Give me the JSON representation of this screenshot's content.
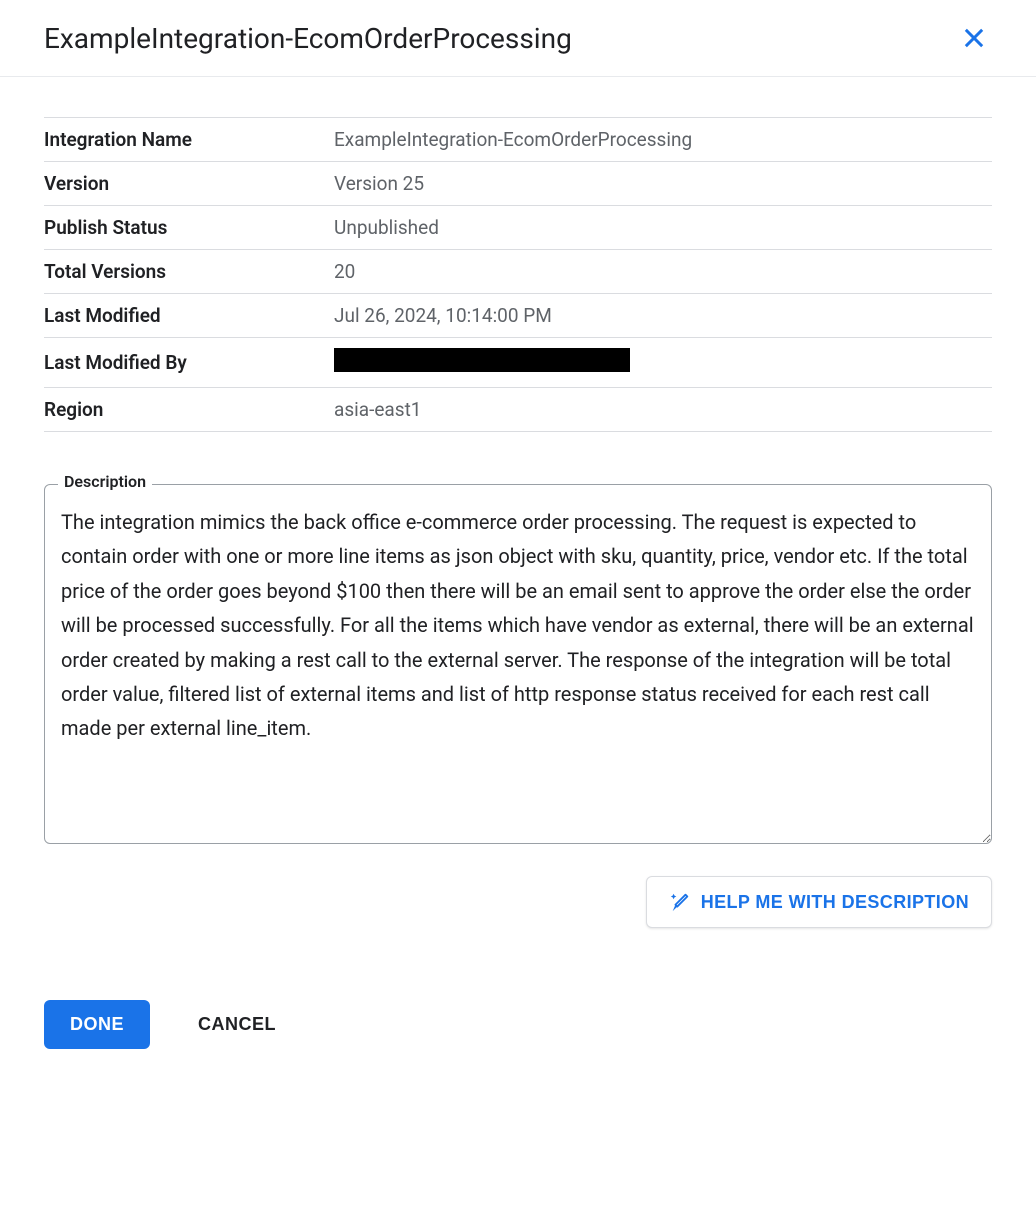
{
  "header": {
    "title": "ExampleIntegration-EcomOrderProcessing"
  },
  "info": {
    "integration_name": {
      "label": "Integration Name",
      "value": "ExampleIntegration-EcomOrderProcessing"
    },
    "version": {
      "label": "Version",
      "value": "Version 25"
    },
    "publish_status": {
      "label": "Publish Status",
      "value": "Unpublished"
    },
    "total_versions": {
      "label": "Total Versions",
      "value": "20"
    },
    "last_modified": {
      "label": "Last Modified",
      "value": "Jul 26, 2024, 10:14:00 PM"
    },
    "last_modified_by": {
      "label": "Last Modified By"
    },
    "region": {
      "label": "Region",
      "value": "asia-east1"
    }
  },
  "description": {
    "label": "Description",
    "value": "The integration mimics the back office e-commerce order processing. The request is expected to contain order with one or more line items as json object with sku, quantity, price, vendor etc. If the total price of the order goes beyond $100 then there will be an email sent to approve the order else the order will be processed successfully. For all the items which have vendor as external, there will be an external order created by making a rest call to the external server. The response of the integration will be total order value, filtered list of external items and list of http response status received for each rest call made per external line_item."
  },
  "buttons": {
    "help_description": "HELP ME WITH DESCRIPTION",
    "done": "DONE",
    "cancel": "CANCEL"
  }
}
